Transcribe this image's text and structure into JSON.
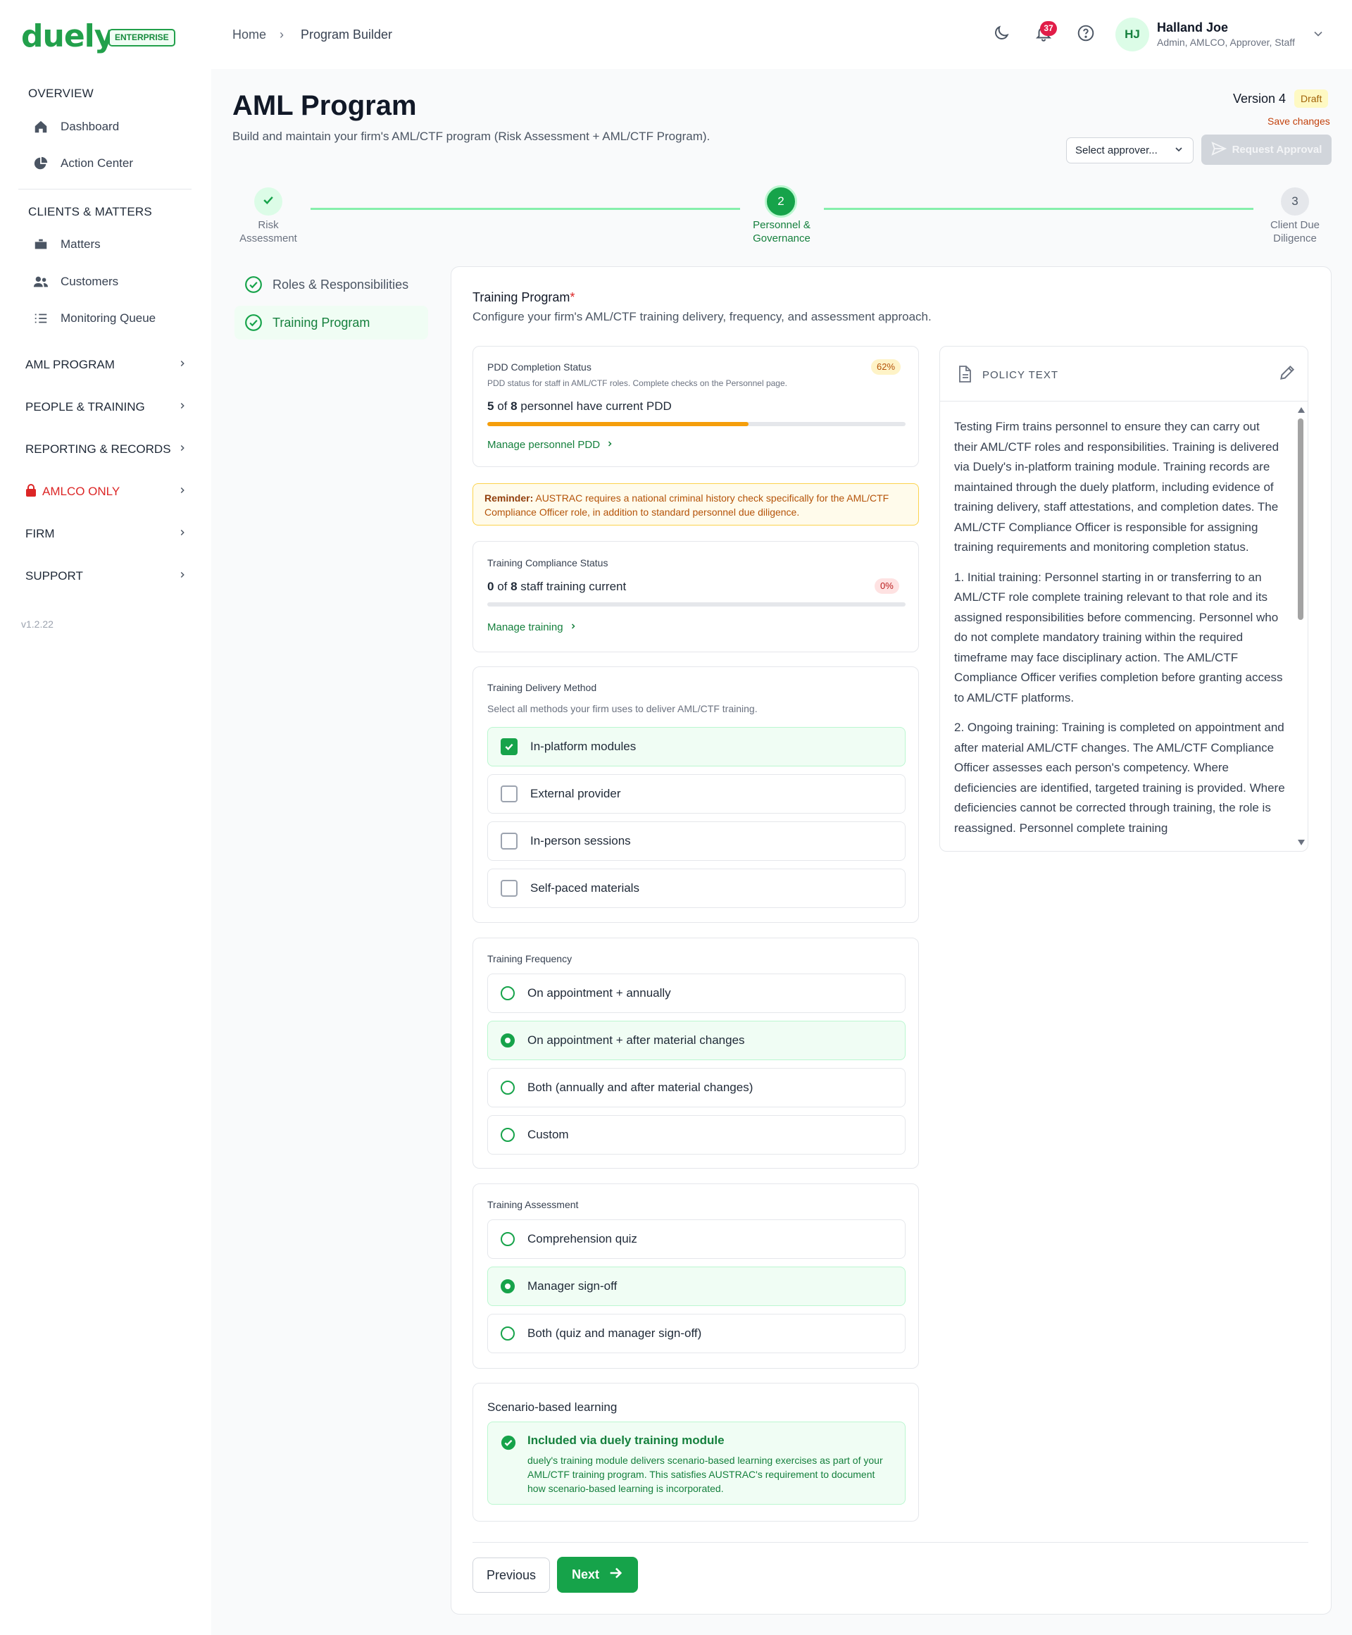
{
  "brand": {
    "logo": "duely",
    "badge": "ENTERPRISE"
  },
  "breadcrumb": {
    "home": "Home",
    "separator": "›",
    "current": "Program Builder"
  },
  "header": {
    "notifications_count": "37",
    "user_initials": "HJ",
    "user_name": "Halland Joe",
    "user_roles": "Admin, AMLCO, Approver, Staff"
  },
  "sidebar": {
    "overview": "OVERVIEW",
    "dashboard": "Dashboard",
    "action_center": "Action Center",
    "clients_matters": "CLIENTS & MATTERS",
    "matters": "Matters",
    "customers": "Customers",
    "monitoring_queue": "Monitoring Queue",
    "groups": [
      "AML PROGRAM",
      "PEOPLE & TRAINING",
      "REPORTING & RECORDS",
      "AMLCO ONLY",
      "FIRM",
      "SUPPORT"
    ],
    "version": "v1.2.22"
  },
  "page": {
    "title": "AML Program",
    "subtitle": "Build and maintain your firm's AML/CTF program (Risk Assessment + AML/CTF Program).",
    "version_label": "Version 4",
    "status": "Draft",
    "save_changes": "Save changes",
    "approver_placeholder": "Select approver...",
    "request_approval": "Request Approval"
  },
  "stepper": {
    "steps": [
      {
        "number": "1",
        "label1": "Risk",
        "label2": "Assessment",
        "state": "complete"
      },
      {
        "number": "2",
        "label1": "Personnel &",
        "label2": "Governance",
        "state": "active"
      },
      {
        "number": "3",
        "label1": "Client Due",
        "label2": "Diligence",
        "state": "pending"
      }
    ]
  },
  "subnav": [
    "Roles & Responsibilities",
    "Training Program"
  ],
  "section": {
    "title": "Training Program",
    "required_mark": "*",
    "subtitle": "Configure your firm's AML/CTF training delivery, frequency, and assessment approach."
  },
  "pdd": {
    "title": "PDD Completion Status",
    "description": "PDD status for staff in AML/CTF roles. Complete checks on the Personnel page.",
    "current": "5",
    "total": "8",
    "summary_mid": " of ",
    "summary_end": " personnel have current PDD",
    "percent_label": "62%",
    "progress": 0.625,
    "link": "Manage personnel PDD"
  },
  "reminder": {
    "prefix": "Reminder:",
    "text": " AUSTRAC requires a national criminal history check specifically for the AML/CTF Compliance Officer role, in addition to standard personnel due diligence."
  },
  "training_status": {
    "title": "Training Compliance Status",
    "current": "0",
    "total": "8",
    "summary_mid": " of ",
    "summary_end": " staff training current",
    "percent_label": "0%",
    "progress": 0,
    "link": "Manage training"
  },
  "delivery": {
    "title": "Training Delivery Method",
    "subtitle": "Select all methods your firm uses to deliver AML/CTF training.",
    "options": [
      {
        "label": "In-platform modules",
        "checked": true
      },
      {
        "label": "External provider",
        "checked": false
      },
      {
        "label": "In-person sessions",
        "checked": false
      },
      {
        "label": "Self-paced materials",
        "checked": false
      }
    ]
  },
  "frequency": {
    "title": "Training Frequency",
    "options": [
      {
        "label": "On appointment + annually",
        "selected": false
      },
      {
        "label": "On appointment + after material changes",
        "selected": true
      },
      {
        "label": "Both (annually and after material changes)",
        "selected": false
      },
      {
        "label": "Custom",
        "selected": false
      }
    ]
  },
  "assessment": {
    "title": "Training Assessment",
    "options": [
      {
        "label": "Comprehension quiz",
        "selected": false
      },
      {
        "label": "Manager sign-off",
        "selected": true
      },
      {
        "label": "Both (quiz and manager sign-off)",
        "selected": false
      }
    ]
  },
  "scenario": {
    "title": "Scenario-based learning",
    "box_title": "Included via duely training module",
    "box_text": "duely's training module delivers scenario-based learning exercises as part of your AML/CTF training program. This satisfies AUSTRAC's requirement to document how scenario-based learning is incorporated."
  },
  "policy": {
    "title": "POLICY TEXT",
    "paragraphs": [
      "Testing Firm trains personnel to ensure they can carry out their AML/CTF roles and responsibilities. Training is delivered via Duely's in-platform training module. Training records are maintained through the duely platform, including evidence of training delivery, staff attestations, and completion dates. The AML/CTF Compliance Officer is responsible for assigning training requirements and monitoring completion status.",
      "1. Initial training: Personnel starting in or transferring to an AML/CTF role complete training relevant to that role and its assigned responsibilities before commencing. Personnel who do not complete mandatory training within the required timeframe may face disciplinary action. The AML/CTF Compliance Officer verifies completion before granting access to AML/CTF platforms.",
      "2. Ongoing training: Training is completed on appointment and after material AML/CTF changes. The AML/CTF Compliance Officer assesses each person's competency. Where deficiencies are identified, targeted training is provided. Where deficiencies cannot be corrected through training, the role is reassigned. Personnel complete training"
    ]
  },
  "footer": {
    "previous": "Previous",
    "next": "Next"
  },
  "colors": {
    "brand_green": "#16a34a",
    "amber": "#f59e0b",
    "danger": "#dc2626"
  }
}
